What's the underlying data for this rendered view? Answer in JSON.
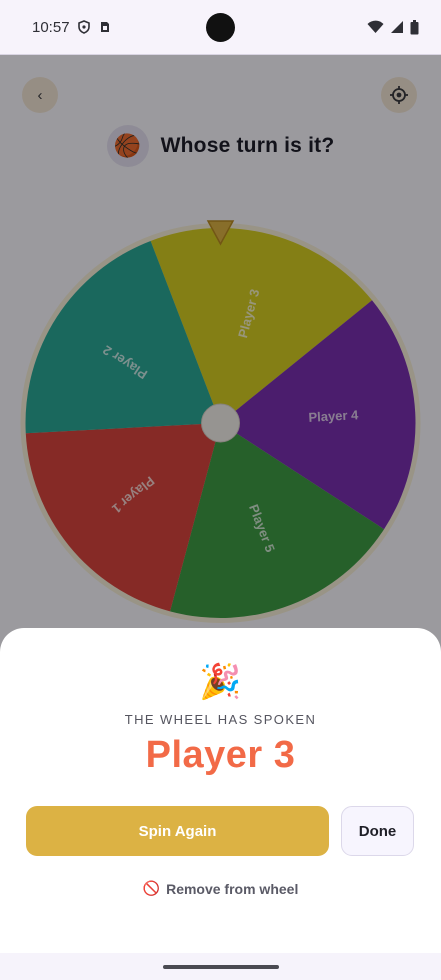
{
  "status_bar": {
    "time": "10:57",
    "left_icons": [
      "shield-icon",
      "sim-card-icon"
    ],
    "right_icons": [
      "wifi-icon",
      "signal-icon",
      "battery-icon"
    ]
  },
  "header": {
    "back_glyph": "‹",
    "ball_emoji": "🏀",
    "title": "Whose turn is it?",
    "settings_icon": "crosshair-settings-icon"
  },
  "wheel": {
    "pointer_icon": "triangle-pointer-icon",
    "segments": [
      {
        "label": "Player 3",
        "color": "#d6ce22"
      },
      {
        "label": "Player 4",
        "color": "#7a2fb1"
      },
      {
        "label": "Player 5",
        "color": "#3e9b45"
      },
      {
        "label": "Player 1",
        "color": "#d8453e"
      },
      {
        "label": "Player 2",
        "color": "#2aa897"
      }
    ]
  },
  "result_sheet": {
    "emoji": "🎉",
    "caption": "THE WHEEL HAS SPOKEN",
    "winner": "Player 3",
    "spin_again_label": "Spin Again",
    "done_label": "Done",
    "remove_icon": "🚫",
    "remove_label": "Remove from wheel"
  },
  "colors": {
    "accent": "#dcb244",
    "winner_text": "#f26a47"
  }
}
